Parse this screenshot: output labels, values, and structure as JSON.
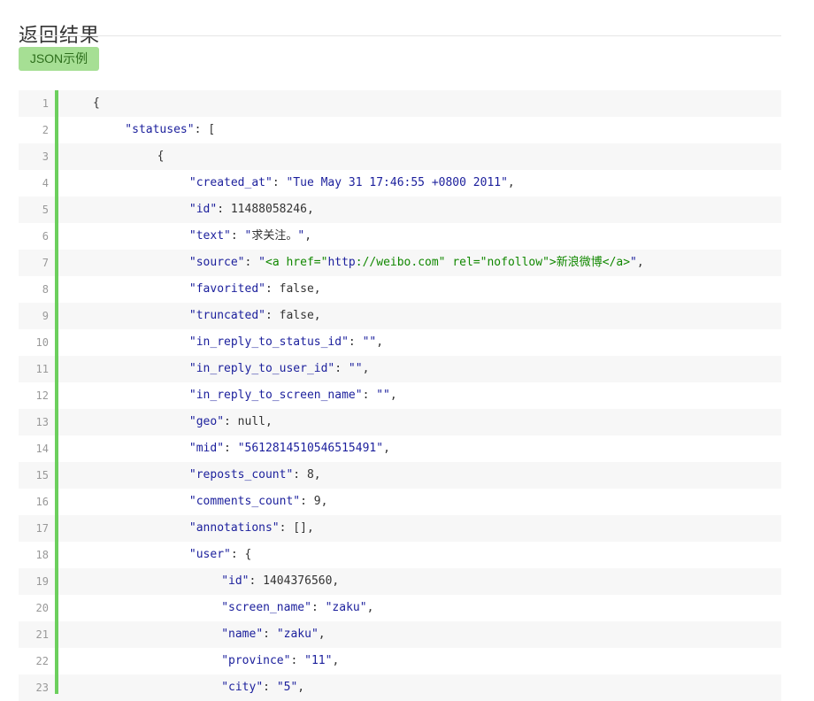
{
  "page": {
    "title": "返回结果",
    "tab_label": "JSON示例"
  },
  "colors": {
    "accent_green": "#6ccf5d",
    "tab_bg": "#a6df94",
    "key_color": "#1b1f9c",
    "html_color": "#118800"
  },
  "code_lines": [
    {
      "n": "1",
      "indent": 0,
      "tokens": [
        {
          "t": "p",
          "v": "{"
        }
      ]
    },
    {
      "n": "2",
      "indent": 1,
      "tokens": [
        {
          "t": "k",
          "v": "\"statuses\""
        },
        {
          "t": "p",
          "v": ": ["
        }
      ]
    },
    {
      "n": "3",
      "indent": 2,
      "tokens": [
        {
          "t": "p",
          "v": "{"
        }
      ]
    },
    {
      "n": "4",
      "indent": 3,
      "tokens": [
        {
          "t": "k",
          "v": "\"created_at\""
        },
        {
          "t": "p",
          "v": ": "
        },
        {
          "t": "s",
          "v": "\"Tue May 31 17:46:55 +0800 2011\""
        },
        {
          "t": "p",
          "v": ","
        }
      ]
    },
    {
      "n": "5",
      "indent": 3,
      "tokens": [
        {
          "t": "k",
          "v": "\"id\""
        },
        {
          "t": "p",
          "v": ": 11488058246,"
        }
      ]
    },
    {
      "n": "6",
      "indent": 3,
      "tokens": [
        {
          "t": "k",
          "v": "\"text\""
        },
        {
          "t": "p",
          "v": ": "
        },
        {
          "t": "s",
          "v": "\""
        },
        {
          "t": "p",
          "v": "求关注。"
        },
        {
          "t": "s",
          "v": "\""
        },
        {
          "t": "p",
          "v": ","
        }
      ]
    },
    {
      "n": "7",
      "indent": 3,
      "tokens": [
        {
          "t": "k",
          "v": "\"source\""
        },
        {
          "t": "p",
          "v": ": "
        },
        {
          "t": "s",
          "v": "\""
        },
        {
          "t": "h",
          "v": "<a href=\""
        },
        {
          "t": "s",
          "v": "http"
        },
        {
          "t": "h",
          "v": "://weibo.com\" rel=\"nofollow\">新浪微博</a>"
        },
        {
          "t": "s",
          "v": "\""
        },
        {
          "t": "p",
          "v": ","
        }
      ]
    },
    {
      "n": "8",
      "indent": 3,
      "tokens": [
        {
          "t": "k",
          "v": "\"favorited\""
        },
        {
          "t": "p",
          "v": ": false,"
        }
      ]
    },
    {
      "n": "9",
      "indent": 3,
      "tokens": [
        {
          "t": "k",
          "v": "\"truncated\""
        },
        {
          "t": "p",
          "v": ": false,"
        }
      ]
    },
    {
      "n": "10",
      "indent": 3,
      "tokens": [
        {
          "t": "k",
          "v": "\"in_reply_to_status_id\""
        },
        {
          "t": "p",
          "v": ": "
        },
        {
          "t": "s",
          "v": "\"\""
        },
        {
          "t": "p",
          "v": ","
        }
      ]
    },
    {
      "n": "11",
      "indent": 3,
      "tokens": [
        {
          "t": "k",
          "v": "\"in_reply_to_user_id\""
        },
        {
          "t": "p",
          "v": ": "
        },
        {
          "t": "s",
          "v": "\"\""
        },
        {
          "t": "p",
          "v": ","
        }
      ]
    },
    {
      "n": "12",
      "indent": 3,
      "tokens": [
        {
          "t": "k",
          "v": "\"in_reply_to_screen_name\""
        },
        {
          "t": "p",
          "v": ": "
        },
        {
          "t": "s",
          "v": "\"\""
        },
        {
          "t": "p",
          "v": ","
        }
      ]
    },
    {
      "n": "13",
      "indent": 3,
      "tokens": [
        {
          "t": "k",
          "v": "\"geo\""
        },
        {
          "t": "p",
          "v": ": null,"
        }
      ]
    },
    {
      "n": "14",
      "indent": 3,
      "tokens": [
        {
          "t": "k",
          "v": "\"mid\""
        },
        {
          "t": "p",
          "v": ": "
        },
        {
          "t": "s",
          "v": "\"5612814510546515491\""
        },
        {
          "t": "p",
          "v": ","
        }
      ]
    },
    {
      "n": "15",
      "indent": 3,
      "tokens": [
        {
          "t": "k",
          "v": "\"reposts_count\""
        },
        {
          "t": "p",
          "v": ": 8,"
        }
      ]
    },
    {
      "n": "16",
      "indent": 3,
      "tokens": [
        {
          "t": "k",
          "v": "\"comments_count\""
        },
        {
          "t": "p",
          "v": ": 9,"
        }
      ]
    },
    {
      "n": "17",
      "indent": 3,
      "tokens": [
        {
          "t": "k",
          "v": "\"annotations\""
        },
        {
          "t": "p",
          "v": ": [],"
        }
      ]
    },
    {
      "n": "18",
      "indent": 3,
      "tokens": [
        {
          "t": "k",
          "v": "\"user\""
        },
        {
          "t": "p",
          "v": ": {"
        }
      ]
    },
    {
      "n": "19",
      "indent": 4,
      "tokens": [
        {
          "t": "k",
          "v": "\"id\""
        },
        {
          "t": "p",
          "v": ": 1404376560,"
        }
      ]
    },
    {
      "n": "20",
      "indent": 4,
      "tokens": [
        {
          "t": "k",
          "v": "\"screen_name\""
        },
        {
          "t": "p",
          "v": ": "
        },
        {
          "t": "s",
          "v": "\"zaku\""
        },
        {
          "t": "p",
          "v": ","
        }
      ]
    },
    {
      "n": "21",
      "indent": 4,
      "tokens": [
        {
          "t": "k",
          "v": "\"name\""
        },
        {
          "t": "p",
          "v": ": "
        },
        {
          "t": "s",
          "v": "\"zaku\""
        },
        {
          "t": "p",
          "v": ","
        }
      ]
    },
    {
      "n": "22",
      "indent": 4,
      "tokens": [
        {
          "t": "k",
          "v": "\"province\""
        },
        {
          "t": "p",
          "v": ": "
        },
        {
          "t": "s",
          "v": "\"11\""
        },
        {
          "t": "p",
          "v": ","
        }
      ]
    },
    {
      "n": "23",
      "indent": 4,
      "tokens": [
        {
          "t": "k",
          "v": "\"city\""
        },
        {
          "t": "p",
          "v": ": "
        },
        {
          "t": "s",
          "v": "\"5\""
        },
        {
          "t": "p",
          "v": ","
        }
      ]
    }
  ]
}
